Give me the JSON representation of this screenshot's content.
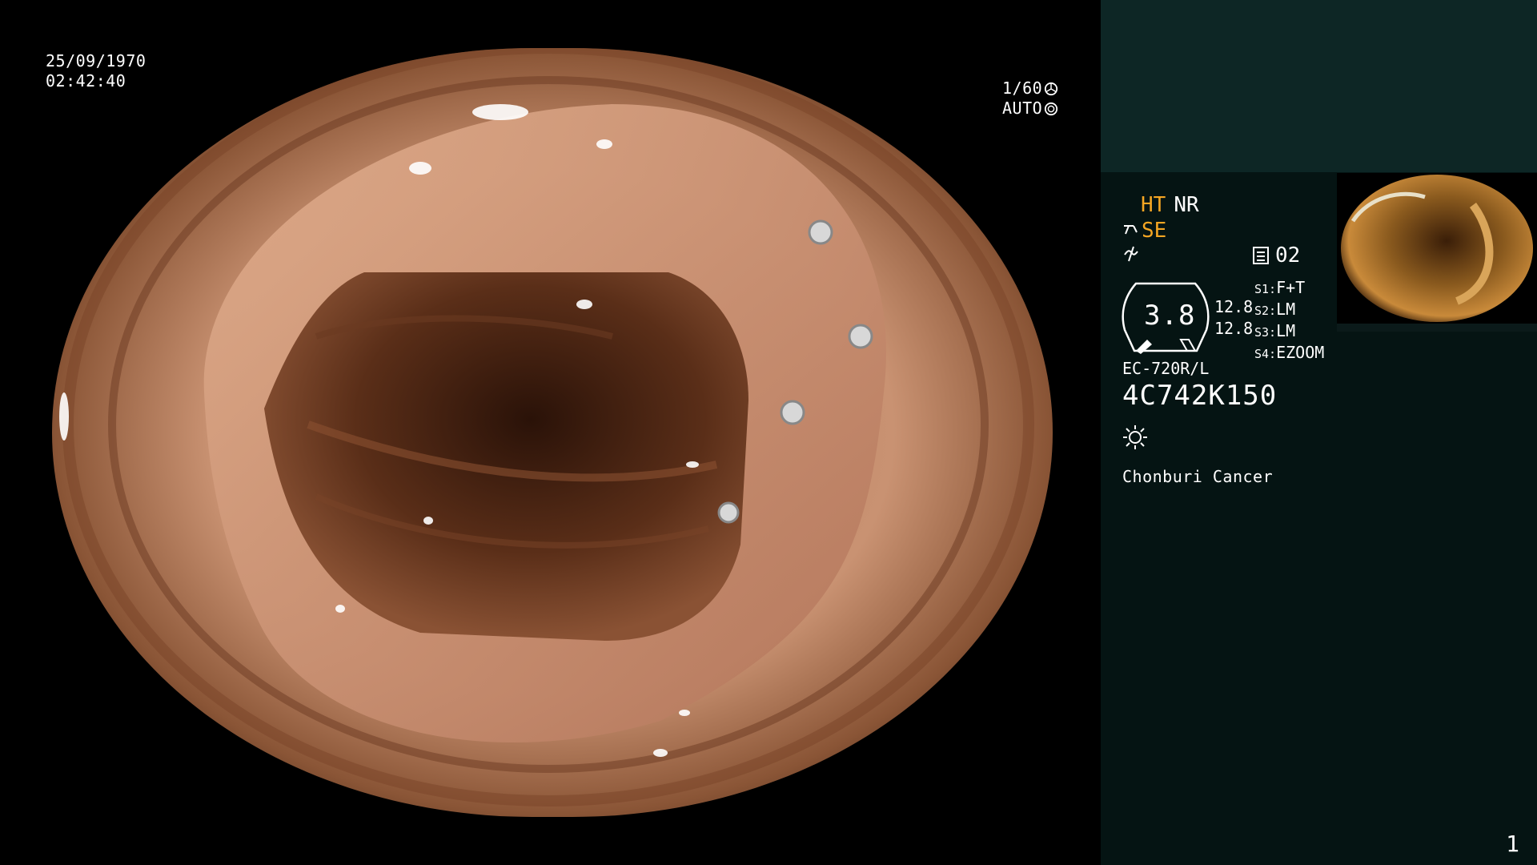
{
  "overlay": {
    "date": "25/09/1970",
    "time": "02:42:40",
    "shutter": "1/60",
    "iris": "AUTO"
  },
  "panel": {
    "ht": "HT",
    "nr": "NR",
    "se": "SE",
    "memory_label": "02",
    "gauge_value": "3.8",
    "side_values": [
      "12.8",
      "12.8"
    ],
    "switches": [
      {
        "key": "S1:",
        "value": "F+T"
      },
      {
        "key": "S2:",
        "value": "LM"
      },
      {
        "key": "S3:",
        "value": "LM"
      },
      {
        "key": "S4:",
        "value": "EZOOM"
      }
    ],
    "scope_model": "EC-720R/L",
    "scope_serial": "4C742K150",
    "hospital": "Chonburi Cancer",
    "page_number": "1"
  },
  "colors": {
    "panel_bg": "#051413",
    "panel_top_bg": "#0d2625",
    "accent_orange": "#f5a623"
  },
  "icons": [
    "shutter-icon",
    "iris-icon",
    "scissors-icon",
    "flash-off-icon",
    "memory-icon",
    "brightness-icon"
  ]
}
